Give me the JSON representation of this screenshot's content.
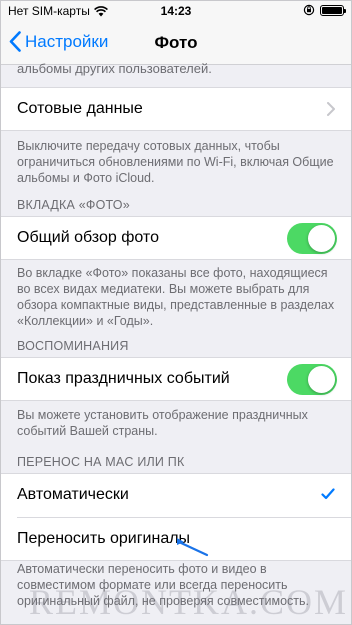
{
  "status_bar": {
    "carrier": "Нет SIM-карты",
    "time": "14:23"
  },
  "nav": {
    "back_label": "Настройки",
    "title": "Фото"
  },
  "partial_footer": "альбомы других пользователей.",
  "cellular": {
    "label": "Сотовые данные",
    "footer": "Выключите передачу сотовых данных, чтобы ограничиться обновлениями по Wi-Fi, включая Общие альбомы и Фото iCloud."
  },
  "photos_tab": {
    "header": "ВКЛАДКА «ФОТО»",
    "toggle_label": "Общий обзор фото",
    "toggle_on": true,
    "footer": "Во вкладке «Фото» показаны все фото, находящиеся во всех видах медиатеки. Вы можете выбрать для обзора компактные виды, представленные в разделах «Коллекции» и «Годы»."
  },
  "memories": {
    "header": "ВОСПОМИНАНИЯ",
    "toggle_label": "Показ праздничных событий",
    "toggle_on": true,
    "footer": "Вы можете установить отображение праздничных событий Вашей страны."
  },
  "transfer": {
    "header": "ПЕРЕНОС НА MAC ИЛИ ПК",
    "options": [
      {
        "label": "Автоматически",
        "selected": true
      },
      {
        "label": "Переносить оригиналы",
        "selected": false
      }
    ],
    "footer": "Автоматически переносить фото и видео в совместимом формате или всегда переносить оригинальный файл, не проверяя совместимость."
  },
  "watermark": "REMONTKA.COM",
  "colors": {
    "accent": "#007aff",
    "toggle_on": "#4cd964",
    "background": "#efeff4",
    "annotation_arrow": "#1a73e8"
  }
}
